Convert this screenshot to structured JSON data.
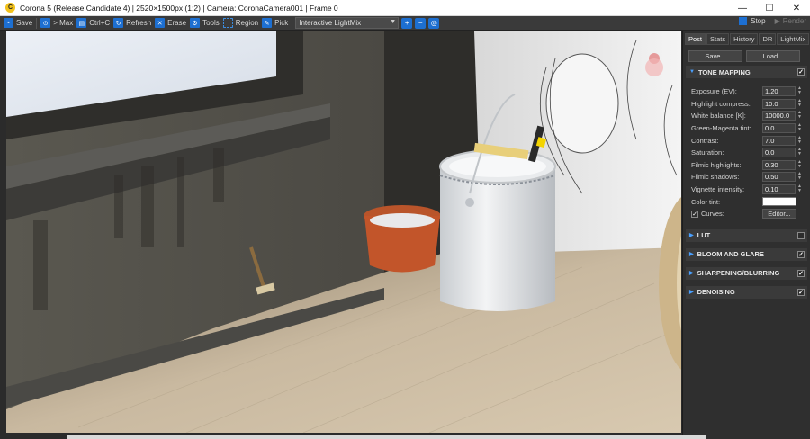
{
  "titlebar": {
    "icon_letter": "C",
    "title": "Corona 5 (Release Candidate 4) | 2520×1500px (1:2) | Camera: CoronaCamera001 | Frame 0",
    "minimize": "—",
    "maximize": "☐",
    "close": "✕"
  },
  "toolbar": {
    "save": "Save",
    "max": "> Max",
    "copy": "Ctrl+C",
    "refresh": "Refresh",
    "erase": "Erase",
    "tools": "Tools",
    "region": "Region",
    "pick": "Pick",
    "dropdown_value": "Interactive LightMix",
    "stop": "Stop",
    "render": "Render"
  },
  "panel": {
    "tabs": [
      "Post",
      "Stats",
      "History",
      "DR",
      "LightMix"
    ],
    "save_button": "Save...",
    "load_button": "Load...",
    "tone_mapping": {
      "header": "TONE MAPPING",
      "params": [
        {
          "label": "Exposure (EV):",
          "value": "1.20"
        },
        {
          "label": "Highlight compress:",
          "value": "10.0"
        },
        {
          "label": "White balance [K]:",
          "value": "10000.0"
        },
        {
          "label": "Green-Magenta tint:",
          "value": "0.0"
        },
        {
          "label": "Contrast:",
          "value": "7.0"
        },
        {
          "label": "Saturation:",
          "value": "0.0"
        },
        {
          "label": "Filmic highlights:",
          "value": "0.30"
        },
        {
          "label": "Filmic shadows:",
          "value": "0.50"
        },
        {
          "label": "Vignette intensity:",
          "value": "0.10"
        }
      ],
      "color_tint_label": "Color tint:",
      "color_tint_value": "#ffffff",
      "curves_label": "Curves:",
      "editor_button": "Editor..."
    },
    "sections": [
      {
        "header": "LUT",
        "checked": false
      },
      {
        "header": "BLOOM AND GLARE",
        "checked": true
      },
      {
        "header": "SHARPENING/BLURRING",
        "checked": true
      },
      {
        "header": "DENOISING",
        "checked": true
      }
    ]
  },
  "colors": {
    "accent": "#1d6fd1",
    "panel_bg": "#2f2f2f",
    "toolbar_bg": "#3a3a3a"
  }
}
